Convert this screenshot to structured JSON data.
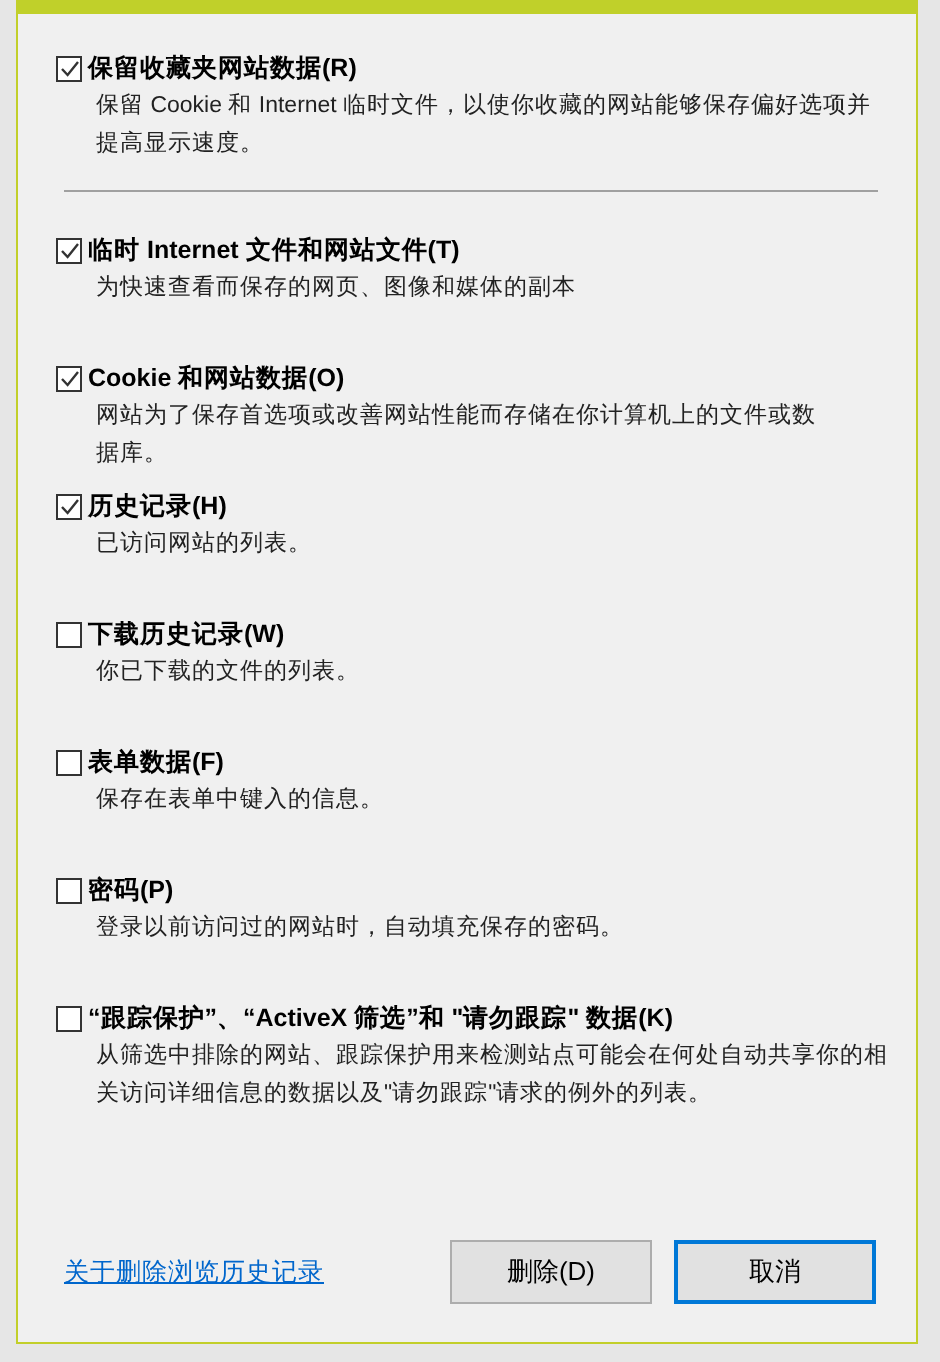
{
  "options": [
    {
      "label": "保留收藏夹网站数据(R)",
      "checked": true,
      "description": [
        "保留 Cookie 和 Internet 临时文件，以使你收藏的网站能够保存偏好选项并",
        "提高显示速度。"
      ]
    },
    {
      "label": "临时 Internet 文件和网站文件(T)",
      "checked": true,
      "description": [
        "为快速查看而保存的网页、图像和媒体的副本"
      ]
    },
    {
      "label": "Cookie 和网站数据(O)",
      "checked": true,
      "description": [
        "网站为了保存首选项或改善网站性能而存储在你计算机上的文件或数",
        "据库。"
      ]
    },
    {
      "label": "历史记录(H)",
      "checked": true,
      "description": [
        "已访问网站的列表。"
      ]
    },
    {
      "label": "下载历史记录(W)",
      "checked": false,
      "description": [
        "你已下载的文件的列表。"
      ]
    },
    {
      "label": "表单数据(F)",
      "checked": false,
      "description": [
        "保存在表单中键入的信息。"
      ]
    },
    {
      "label": "密码(P)",
      "checked": false,
      "description": [
        "登录以前访问过的网站时，自动填充保存的密码。"
      ]
    },
    {
      "label": "“跟踪保护”、“ActiveX 筛选”和 \"请勿跟踪\" 数据(K)",
      "checked": false,
      "description": [
        "从筛选中排除的网站、跟踪保护用来检测站点可能会在何处自动共享你的相",
        "关访问详细信息的数据以及\"请勿跟踪\"请求的例外的列表。"
      ]
    }
  ],
  "help_link": "关于删除浏览历史记录",
  "buttons": [
    {
      "label": "删除(D)",
      "focused": false
    },
    {
      "label": "取消",
      "focused": true
    }
  ]
}
